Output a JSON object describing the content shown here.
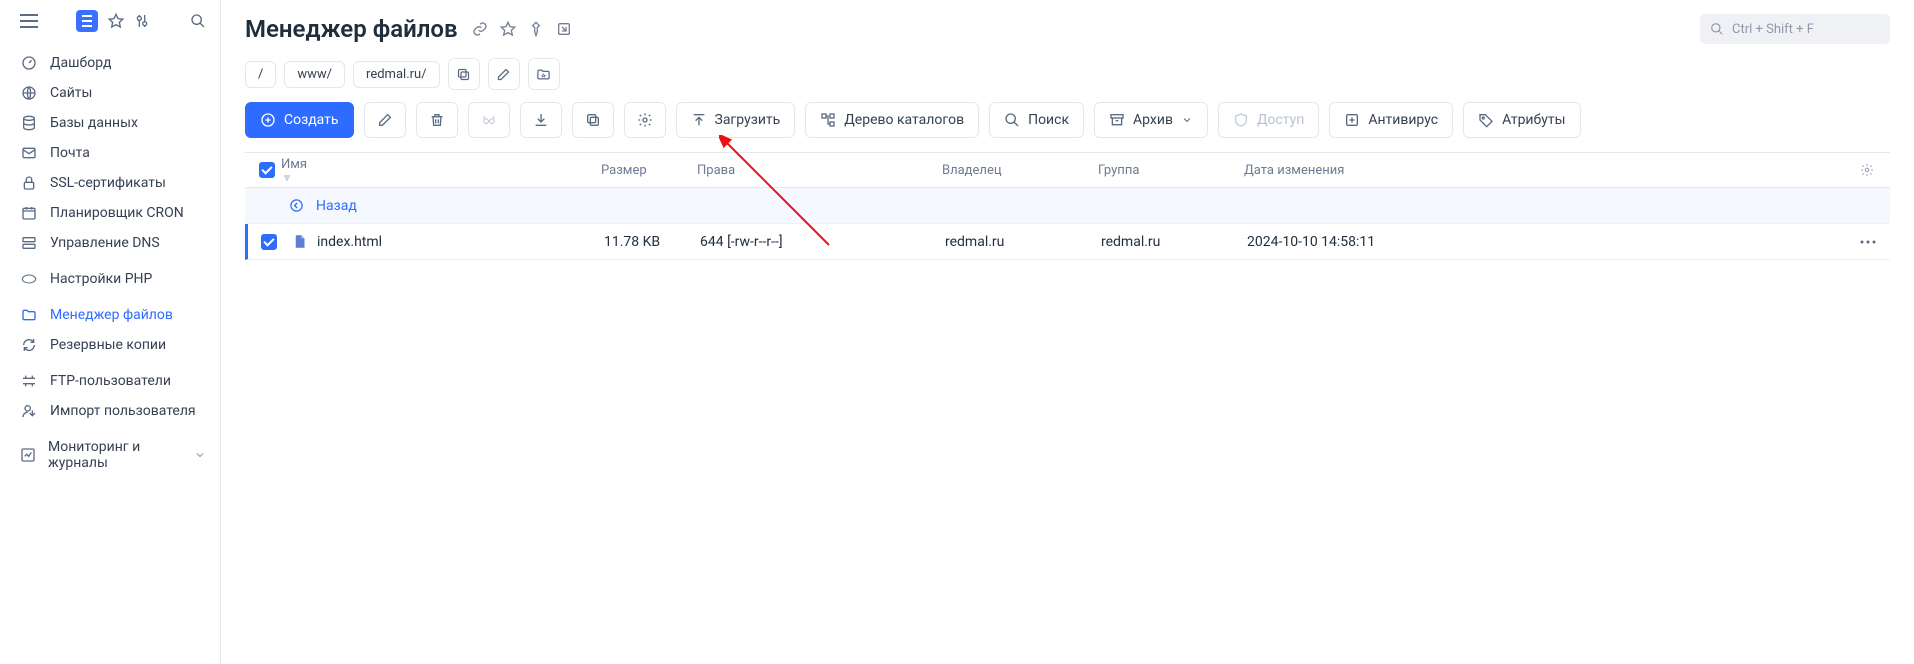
{
  "page": {
    "title": "Менеджер файлов"
  },
  "search": {
    "placeholder": "Ctrl + Shift + F"
  },
  "sidebar": {
    "items": [
      {
        "label": "Дашборд"
      },
      {
        "label": "Сайты"
      },
      {
        "label": "Базы данных"
      },
      {
        "label": "Почта"
      },
      {
        "label": "SSL-сертификаты"
      },
      {
        "label": "Планировщик CRON"
      },
      {
        "label": "Управление DNS"
      },
      {
        "label": "Настройки PHP"
      },
      {
        "label": "Менеджер файлов"
      },
      {
        "label": "Резервные копии"
      },
      {
        "label": "FTP-пользователи"
      },
      {
        "label": "Импорт пользователя"
      },
      {
        "label": "Мониторинг и журналы"
      }
    ]
  },
  "breadcrumb": {
    "root": "/",
    "www": "www/",
    "domain": "redmal.ru/"
  },
  "toolbar": {
    "create": "Создать",
    "upload": "Загрузить",
    "tree": "Дерево каталогов",
    "search": "Поиск",
    "archive": "Архив",
    "access": "Доступ",
    "antivirus": "Антивирус",
    "attributes": "Атрибуты"
  },
  "table": {
    "headers": {
      "name": "Имя",
      "size": "Размер",
      "perm": "Права",
      "owner": "Владелец",
      "group": "Группа",
      "date": "Дата изменения"
    },
    "back": "Назад",
    "rows": [
      {
        "name": "index.html",
        "size": "11.78 KB",
        "perm": "644 [-rw-r--r--]",
        "owner": "redmal.ru",
        "group": "redmal.ru",
        "date": "2024-10-10 14:58:11"
      }
    ]
  }
}
